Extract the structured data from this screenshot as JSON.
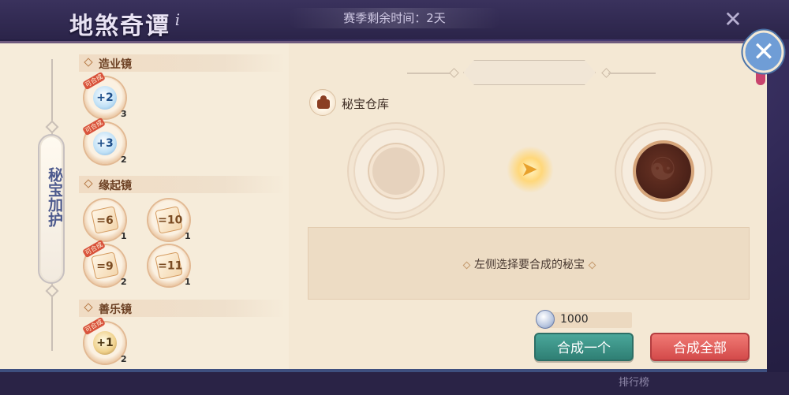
{
  "header": {
    "title": "地煞奇谭",
    "info_icon": "i",
    "season_timer": "赛季剩余时间：2天",
    "bg_close_icon": "✕"
  },
  "footer": {
    "ranking_label": "排行榜"
  },
  "sidebar": {
    "tab_label": "秘宝加护"
  },
  "categories": [
    {
      "title": "造业镜",
      "items": [
        {
          "label": "+2",
          "badge": "可合成",
          "count": "3"
        },
        {
          "label": "+3",
          "badge": "可合成",
          "count": "2"
        }
      ]
    },
    {
      "title": "缘起镜",
      "items": [
        {
          "label": "=6",
          "badge": "",
          "count": "1"
        },
        {
          "label": "=10",
          "badge": "",
          "count": "1"
        },
        {
          "label": "=9",
          "badge": "可合成",
          "count": "2"
        },
        {
          "label": "=11",
          "badge": "",
          "count": "1"
        }
      ]
    },
    {
      "title": "善乐镜",
      "items": [
        {
          "label": "+1",
          "badge": "可合成",
          "count": "2"
        }
      ]
    }
  ],
  "main": {
    "warehouse_label": "秘宝仓库",
    "hint_text": "左侧选择要合成的秘宝",
    "coin_amount": "1000",
    "combine_one_label": "合成一个",
    "combine_all_label": "合成全部"
  },
  "colors": {
    "panel_bg": "#f3e7d2",
    "accent_green": "#3a9084",
    "accent_red": "#e05e5c",
    "close_blue": "#6f9dd6"
  },
  "icons": {
    "warehouse": "treasure-pot-icon",
    "arrow": "glowing-arrow-icon",
    "coin": "silver-coin-icon",
    "close": "close-icon"
  }
}
